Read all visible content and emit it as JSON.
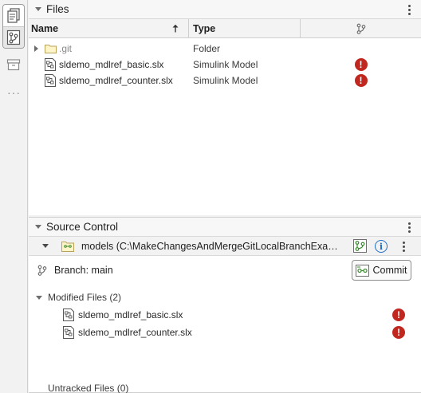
{
  "files_panel": {
    "title": "Files",
    "columns": {
      "name": "Name",
      "type": "Type"
    },
    "rows": [
      {
        "name": ".git",
        "type": "Folder",
        "kind": "folder",
        "status": ""
      },
      {
        "name": "sldemo_mdlref_basic.slx",
        "type": "Simulink Model",
        "kind": "model",
        "status": "error"
      },
      {
        "name": "sldemo_mdlref_counter.slx",
        "type": "Simulink Model",
        "kind": "model",
        "status": "error"
      }
    ]
  },
  "source_control": {
    "title": "Source Control",
    "repo_label": "models (C:\\MakeChangesAndMergeGitLocalBranchExamp...",
    "branch": "Branch: main",
    "commit_label": "Commit",
    "modified_header": "Modified Files (2)",
    "modified_files": [
      {
        "name": "sldemo_mdlref_basic.slx",
        "status": "error"
      },
      {
        "name": "sldemo_mdlref_counter.slx",
        "status": "error"
      }
    ],
    "untracked_header": "Untracked Files (0)"
  },
  "icons": {
    "error": "!",
    "info": "i"
  },
  "colors": {
    "error": "#c0281f",
    "info": "#1f6fc5",
    "git_green": "#3a8a2e"
  }
}
